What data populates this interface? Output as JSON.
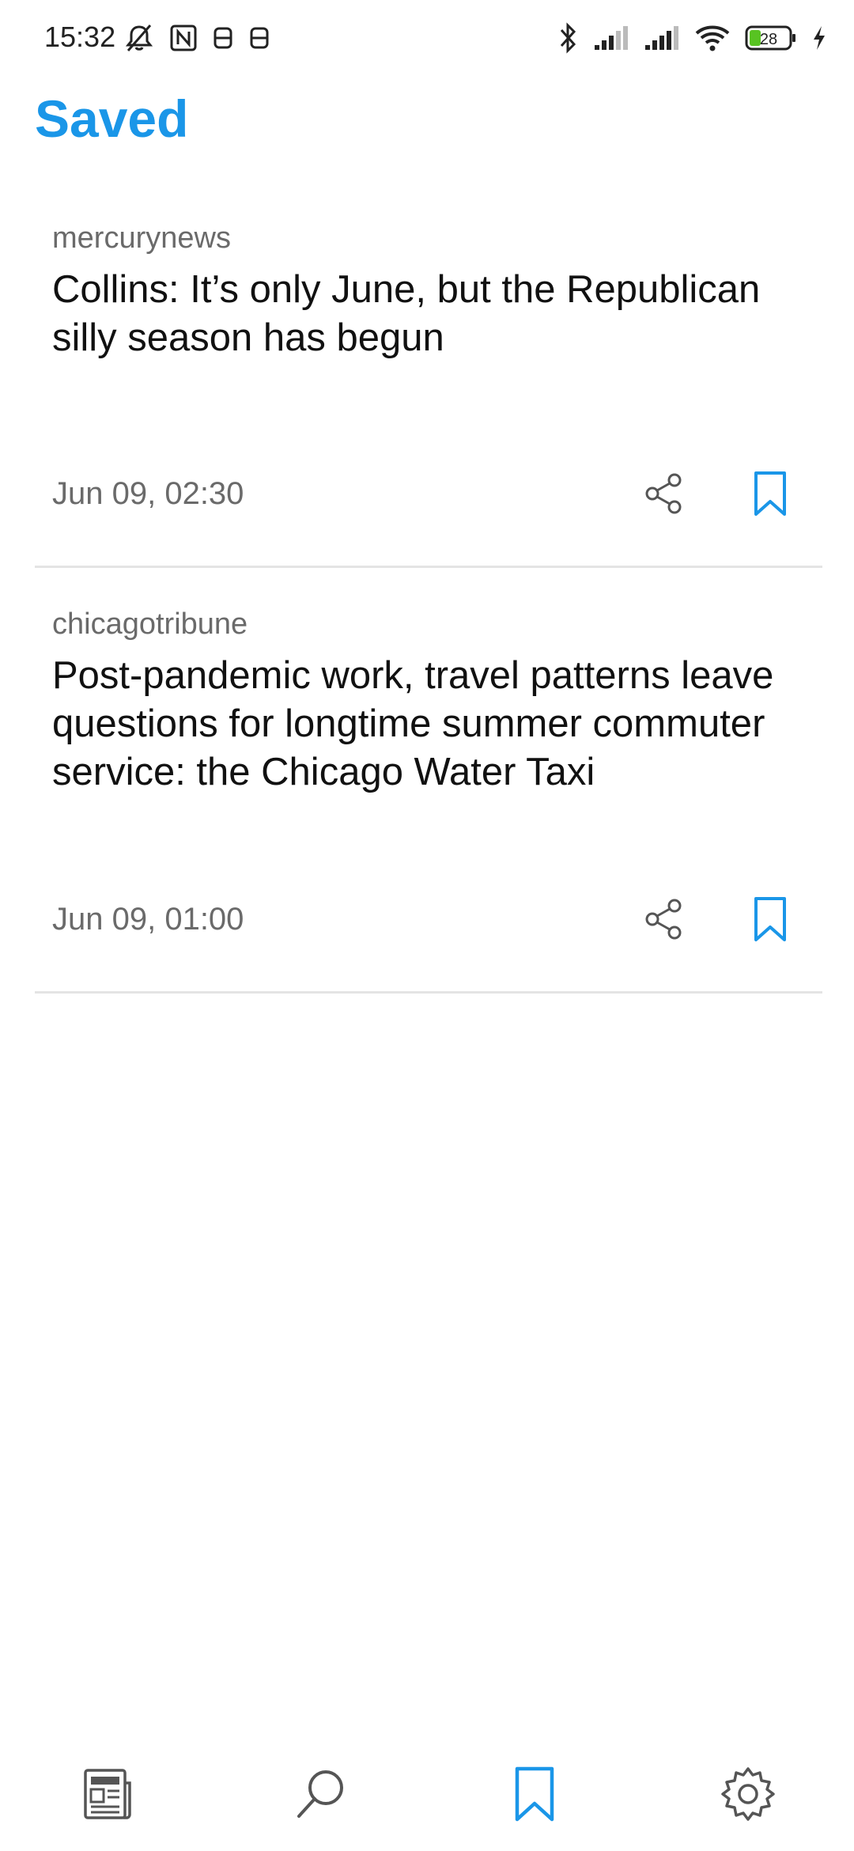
{
  "status_bar": {
    "time": "15:32",
    "battery_level": "28",
    "icons": [
      "mute-icon",
      "nfc-icon",
      "notification-icon",
      "notification-icon",
      "bluetooth-icon",
      "signal-icon",
      "signal-icon",
      "wifi-icon",
      "battery-icon",
      "charging-icon"
    ]
  },
  "header": {
    "title": "Saved"
  },
  "articles": [
    {
      "source": "mercurynews",
      "title": "Collins: It’s only June, but the Republican silly season has begun",
      "date": "Jun 09, 02:30"
    },
    {
      "source": "chicagotribune",
      "title": "Post-pandemic work, travel patterns leave questions for longtime summer commuter service: the Chicago Water Taxi",
      "date": "Jun 09, 01:00"
    }
  ],
  "bottom_nav": {
    "items": [
      "news-icon",
      "search-icon",
      "bookmark-icon",
      "settings-icon"
    ],
    "active": "bookmark-icon"
  },
  "colors": {
    "accent": "#1a96e8",
    "text_primary": "#111111",
    "text_secondary": "#6a6a6a",
    "divider": "#e4e4e4",
    "icon_inactive": "#555555"
  }
}
